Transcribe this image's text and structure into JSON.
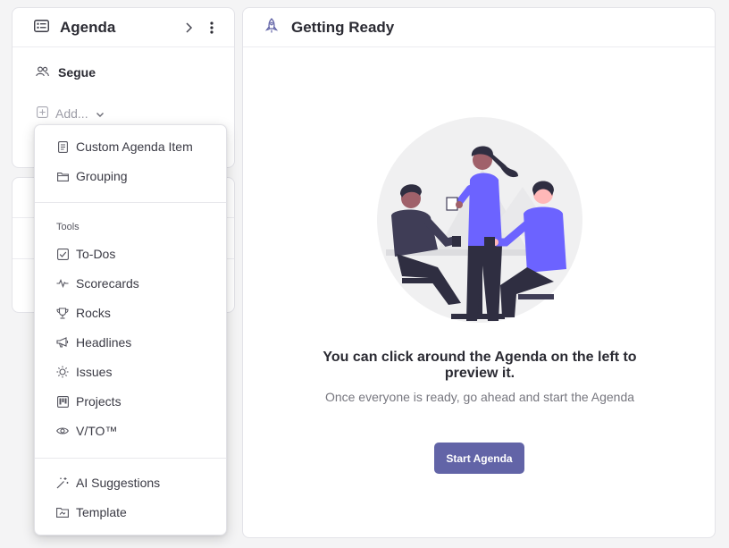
{
  "agenda_panel": {
    "title": "Agenda",
    "items": [
      {
        "label": "Segue",
        "icon": "people-icon"
      }
    ],
    "add_label": "Add..."
  },
  "add_menu": {
    "items": [
      {
        "label": "Custom Agenda Item",
        "icon": "document-icon"
      },
      {
        "label": "Grouping",
        "icon": "folder-icon"
      }
    ],
    "tools_heading": "Tools",
    "tools": [
      {
        "label": "To-Dos",
        "icon": "checkbox-icon"
      },
      {
        "label": "Scorecards",
        "icon": "pulse-icon"
      },
      {
        "label": "Rocks",
        "icon": "trophy-icon"
      },
      {
        "label": "Headlines",
        "icon": "megaphone-icon"
      },
      {
        "label": "Issues",
        "icon": "sun-icon"
      },
      {
        "label": "Projects",
        "icon": "kanban-icon"
      },
      {
        "label": "V/TO™",
        "icon": "eye-icon"
      }
    ],
    "extras": [
      {
        "label": "AI Suggestions",
        "icon": "magic-wand-icon"
      },
      {
        "label": "Template",
        "icon": "template-icon"
      }
    ]
  },
  "main_panel": {
    "title": "Getting Ready",
    "icon": "rocket-icon",
    "message": "You can click around the Agenda on the left to preview it.",
    "submessage": "Once everyone is ready, go ahead and start the Agenda",
    "start_button": "Start Agenda"
  },
  "colors": {
    "accent": "#6264a7",
    "illustration_purple": "#6c63ff",
    "illustration_dark": "#3f3d56",
    "text_dark": "#2b2b33",
    "text_muted": "#77777f"
  }
}
